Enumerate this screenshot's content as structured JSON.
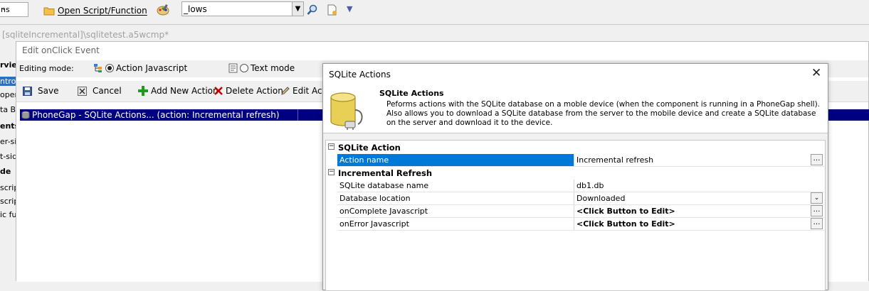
{
  "toolbar": {
    "left_combo_value": "ns",
    "open_script_label": "Open Script/Function",
    "search_value": "_lows"
  },
  "document_tab": "[sqliteIncremental]\\sqlitetest.a5wcmp*",
  "left_panel": {
    "items": [
      "rvie",
      "ntro",
      "opert",
      "ta Bi",
      "ents",
      "er-sic",
      "t-sid",
      "de",
      "scrip",
      "scrip",
      "ic fu"
    ]
  },
  "edit_window": {
    "title": "Edit onClick Event",
    "editing_mode_label": "Editing mode:",
    "mode_action_js": "Action Javascript",
    "mode_text": "Text mode",
    "selected_mode": "Action Javascript",
    "buttons": {
      "save": "Save",
      "cancel": "Cancel",
      "add_new_action": "Add New Action",
      "delete_action": "Delete Action",
      "edit_action": "Edit Actio"
    },
    "action_row": "PhoneGap - SQLite Actions... (action: Incremental refresh)"
  },
  "sqlite_dialog": {
    "title": "SQLite Actions",
    "header_title": "SQLite Actions",
    "header_desc": "Peforms actions with the SQLite database on a moble device (when the component is running in a PhoneGap shell). Also allows you to download a SQLite database from the server to the mobile device and create a SQLite database on the server and download it to the device.",
    "categories": [
      {
        "label": "SQLite Action",
        "rows": [
          {
            "name": "Action name",
            "value": "Incremental refresh"
          }
        ]
      },
      {
        "label": "Incremental Refresh",
        "rows": [
          {
            "name": "SQLite database name",
            "value": "db1.db"
          },
          {
            "name": "Database location",
            "value": "Downloaded"
          },
          {
            "name": "onComplete Javascript",
            "value": "<Click Button to Edit>"
          },
          {
            "name": "onError Javascript",
            "value": "<Click Button to Edit>"
          }
        ]
      }
    ]
  },
  "colors": {
    "selection_navy": "#000080",
    "selection_blue": "#0078d7",
    "delete_red": "#c00000",
    "add_green": "#1e9e1e"
  }
}
